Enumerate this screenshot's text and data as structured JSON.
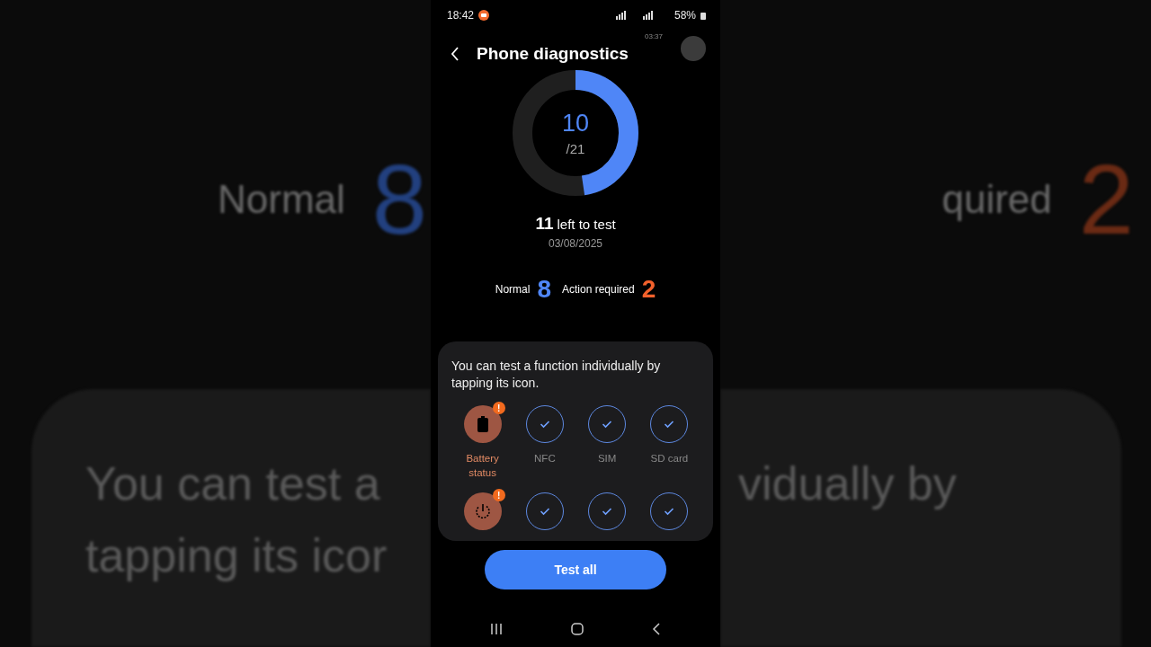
{
  "backdrop": {
    "left_label": "Normal",
    "left_count": "8",
    "right_label": "quired",
    "right_count": "2",
    "card_lines_left": [
      "You can test a",
      "tapping its icor"
    ],
    "card_lines_right": [
      "vidually by"
    ]
  },
  "status_bar": {
    "time": "18:42",
    "battery": "58%"
  },
  "recorder": {
    "timer": "03:37"
  },
  "header": {
    "title": "Phone diagnostics"
  },
  "progress": {
    "tested": "10",
    "total": "/21",
    "level": 0.476
  },
  "summary": {
    "left_count": "11",
    "left_label": "left to test",
    "date": "03/08/2025"
  },
  "stats": [
    {
      "label": "Normal",
      "count": "8",
      "kind": "normal"
    },
    {
      "label": "Action required",
      "count": "2",
      "kind": "action"
    }
  ],
  "card": {
    "hint": "You can test a function individually by tapping its icon.",
    "items": [
      {
        "label": "Battery status",
        "kind": "battery",
        "badge": "!"
      },
      {
        "label": "NFC",
        "kind": "passed"
      },
      {
        "label": "SIM",
        "kind": "passed"
      },
      {
        "label": "SD card",
        "kind": "passed"
      },
      {
        "kind": "power",
        "badge": "!"
      },
      {
        "kind": "passed"
      },
      {
        "kind": "passed"
      },
      {
        "kind": "passed"
      }
    ]
  },
  "button": "Test all"
}
